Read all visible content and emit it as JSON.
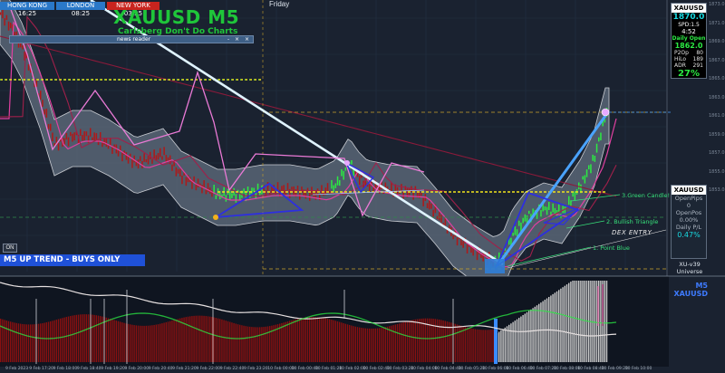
{
  "sessions": [
    {
      "label": "HONG KONG 16:25",
      "color": "#2a78c8"
    },
    {
      "label": "LONDON 08:25",
      "color": "#2a78c8"
    },
    {
      "label": "NEW YORK 03:25",
      "color": "#c8241e"
    }
  ],
  "title": "XAUUSD M5",
  "subtitle": "Carlsberg Don't Do Charts",
  "news_reader": {
    "label": "news reader",
    "buttons": "- × ×"
  },
  "day_label": "Friday",
  "on_button": "ON",
  "trend_banner": "M5 UP TREND - BUYS ONLY",
  "annotations": {
    "green_candle": "3.Green Candle!!",
    "bullish_triangle": "2. Bullish Triangle",
    "dex_entry": "DEX ENTRY",
    "point_blue": "1. Point Blue"
  },
  "price_axis_labels": [
    "1873.0",
    "1871.0",
    "1869.0",
    "1867.0",
    "1865.0",
    "1863.0",
    "1861.0",
    "1859.0",
    "1857.0",
    "1855.0",
    "1853.0"
  ],
  "info_panel": {
    "symbol": "XAUUSD",
    "price": "1870.0",
    "spread": "SPD:1.5",
    "time": "4:52",
    "daily_open_label": "Daily Open",
    "daily_open_value": "1862.0",
    "rows": [
      {
        "label": "P2Op",
        "value": "80"
      },
      {
        "label": "HiLo",
        "value": "189"
      },
      {
        "label": "ADR",
        "value": "291"
      }
    ],
    "adr_percent": "27%"
  },
  "account_panel": {
    "symbol": "XAUUSD",
    "open_pips_label": "OpenPips",
    "open_pips_value": "0",
    "open_pos_label": "OpenPos",
    "open_pos_value": "0.00%",
    "daily_pl_label": "Daily P/L",
    "daily_pl_value": "0.47%"
  },
  "version": {
    "line1": "XU-v39",
    "line2": "Universe"
  },
  "timeframe": {
    "tf": "M5",
    "symbol": "XAUUSD"
  },
  "time_axis_labels": [
    "9 Feb 2023",
    "9 Feb 17:20",
    "9 Feb 18:00",
    "9 Feb 18:40",
    "9 Feb 19:20",
    "9 Feb 20:00",
    "9 Feb 20:40",
    "9 Feb 21:20",
    "9 Feb 22:00",
    "9 Feb 22:40",
    "9 Feb 23:20",
    "10 Feb 00:00",
    "10 Feb 00:40",
    "10 Feb 01:20",
    "10 Feb 02:00",
    "10 Feb 02:40",
    "10 Feb 03:20",
    "10 Feb 04:00",
    "10 Feb 04:40",
    "10 Feb 05:20",
    "10 Feb 06:00",
    "10 Feb 06:40",
    "10 Feb 07:20",
    "10 Feb 08:00",
    "10 Feb 08:40",
    "10 Feb 09:20",
    "10 Feb 10:00"
  ],
  "colors": {
    "background": "#1a2230",
    "bullish": "#2bea43",
    "bearish": "#b01818",
    "accent": "#19d9e0",
    "channel": "#c9ccd2"
  }
}
